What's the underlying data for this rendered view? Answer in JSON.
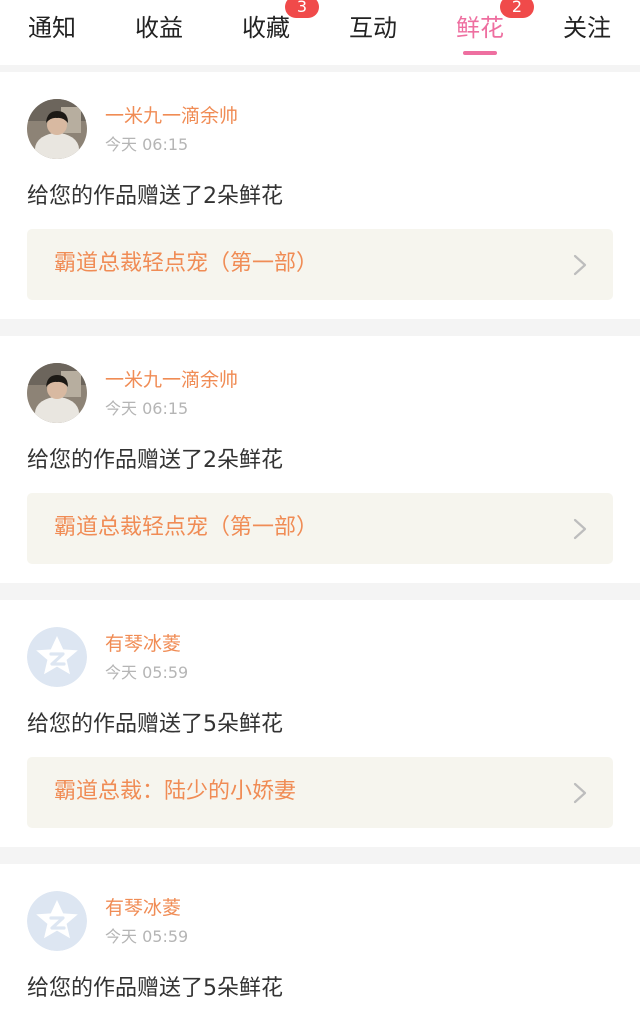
{
  "tabs": [
    {
      "label": "通知",
      "badge": ""
    },
    {
      "label": "收益",
      "badge": ""
    },
    {
      "label": "收藏",
      "badge": "3"
    },
    {
      "label": "互动",
      "badge": ""
    },
    {
      "label": "鲜花",
      "badge": "2",
      "active": true
    },
    {
      "label": "关注",
      "badge": ""
    }
  ],
  "colors": {
    "accent_pink": "#ee6fa0",
    "username_orange": "#f08c55",
    "badge_red": "#f04a4a",
    "link_bg": "#f6f5ee"
  },
  "feed": [
    {
      "user": "一米九一滴余帅",
      "time": "今天 06:15",
      "avatar": "photo-avatar",
      "message": "给您的作品赠送了2朵鲜花",
      "work_title": "霸道总裁轻点宠（第一部）"
    },
    {
      "user": "一米九一滴余帅",
      "time": "今天 06:15",
      "avatar": "photo-avatar",
      "message": "给您的作品赠送了2朵鲜花",
      "work_title": "霸道总裁轻点宠（第一部）"
    },
    {
      "user": "有琴冰菱",
      "time": "今天 05:59",
      "avatar": "default-qzone-star-avatar",
      "message": "给您的作品赠送了5朵鲜花",
      "work_title": "霸道总裁：陆少的小娇妻"
    },
    {
      "user": "有琴冰菱",
      "time": "今天 05:59",
      "avatar": "default-qzone-star-avatar",
      "message": "给您的作品赠送了5朵鲜花",
      "work_title": ""
    }
  ]
}
